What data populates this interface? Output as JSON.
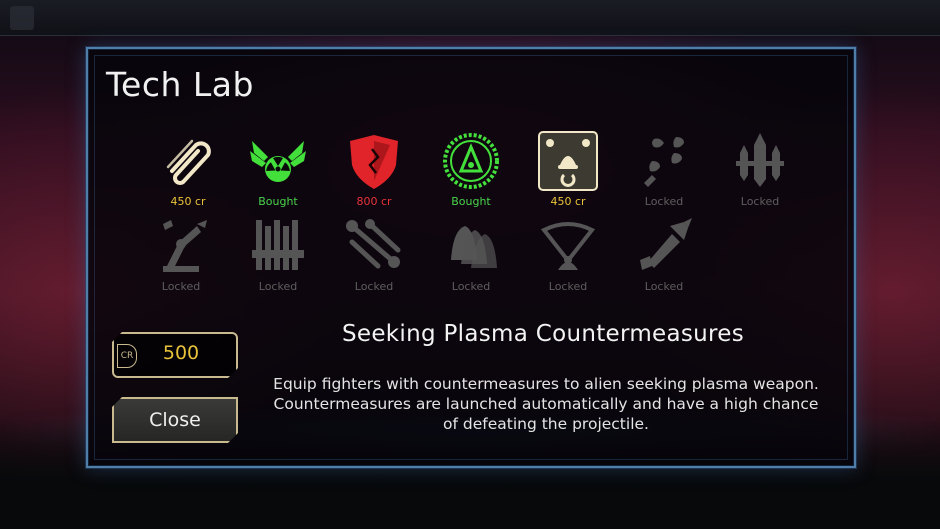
{
  "dialog": {
    "title": "Tech Lab"
  },
  "tech_items": [
    {
      "icon": "paperclip-icon",
      "label": "450 cr",
      "status": "price",
      "color": "#f2e8c8"
    },
    {
      "icon": "winged-radiation-icon",
      "label": "Bought",
      "status": "bought",
      "color": "#43e03c"
    },
    {
      "icon": "shield-icon",
      "label": "800 cr",
      "status": "unaffordable",
      "color": "#e0242a"
    },
    {
      "icon": "sensor-dish-icon",
      "label": "Bought",
      "status": "bought",
      "color": "#43e03c"
    },
    {
      "icon": "countermeasure-icon",
      "label": "450 cr",
      "status": "price",
      "color": "#f2e8c8"
    },
    {
      "icon": "projectiles-icon",
      "label": "Locked",
      "status": "locked",
      "color": "#555555"
    },
    {
      "icon": "rockets-icon",
      "label": "Locked",
      "status": "locked",
      "color": "#555555"
    },
    {
      "icon": "robotic-arm-icon",
      "label": "Locked",
      "status": "locked",
      "color": "#555555"
    },
    {
      "icon": "guitar-pair-icon",
      "label": "Locked",
      "status": "locked",
      "color": "#555555"
    },
    {
      "icon": "wrenches-icon",
      "label": "Locked",
      "status": "locked",
      "color": "#555555"
    },
    {
      "icon": "stacked-hulls-icon",
      "label": "Locked",
      "status": "locked",
      "color": "#555555"
    },
    {
      "icon": "fan-icon",
      "label": "Locked",
      "status": "locked",
      "color": "#555555"
    },
    {
      "icon": "missile-icon",
      "label": "Locked",
      "status": "locked",
      "color": "#555555"
    }
  ],
  "credits": {
    "badge": "CR",
    "value": "500"
  },
  "close_label": "Close",
  "description": {
    "title": "Seeking Plasma Countermeasures",
    "text": "Equip fighters with countermeasures to alien seeking plasma weapon. Countermeasures are launched automatically and have a high chance of defeating the projectile."
  },
  "colors": {
    "frame": "#4f7ea8",
    "price": "#e8c23a",
    "bought": "#49d44b",
    "unaffordable": "#e8323a",
    "locked": "#5e5e5e"
  }
}
